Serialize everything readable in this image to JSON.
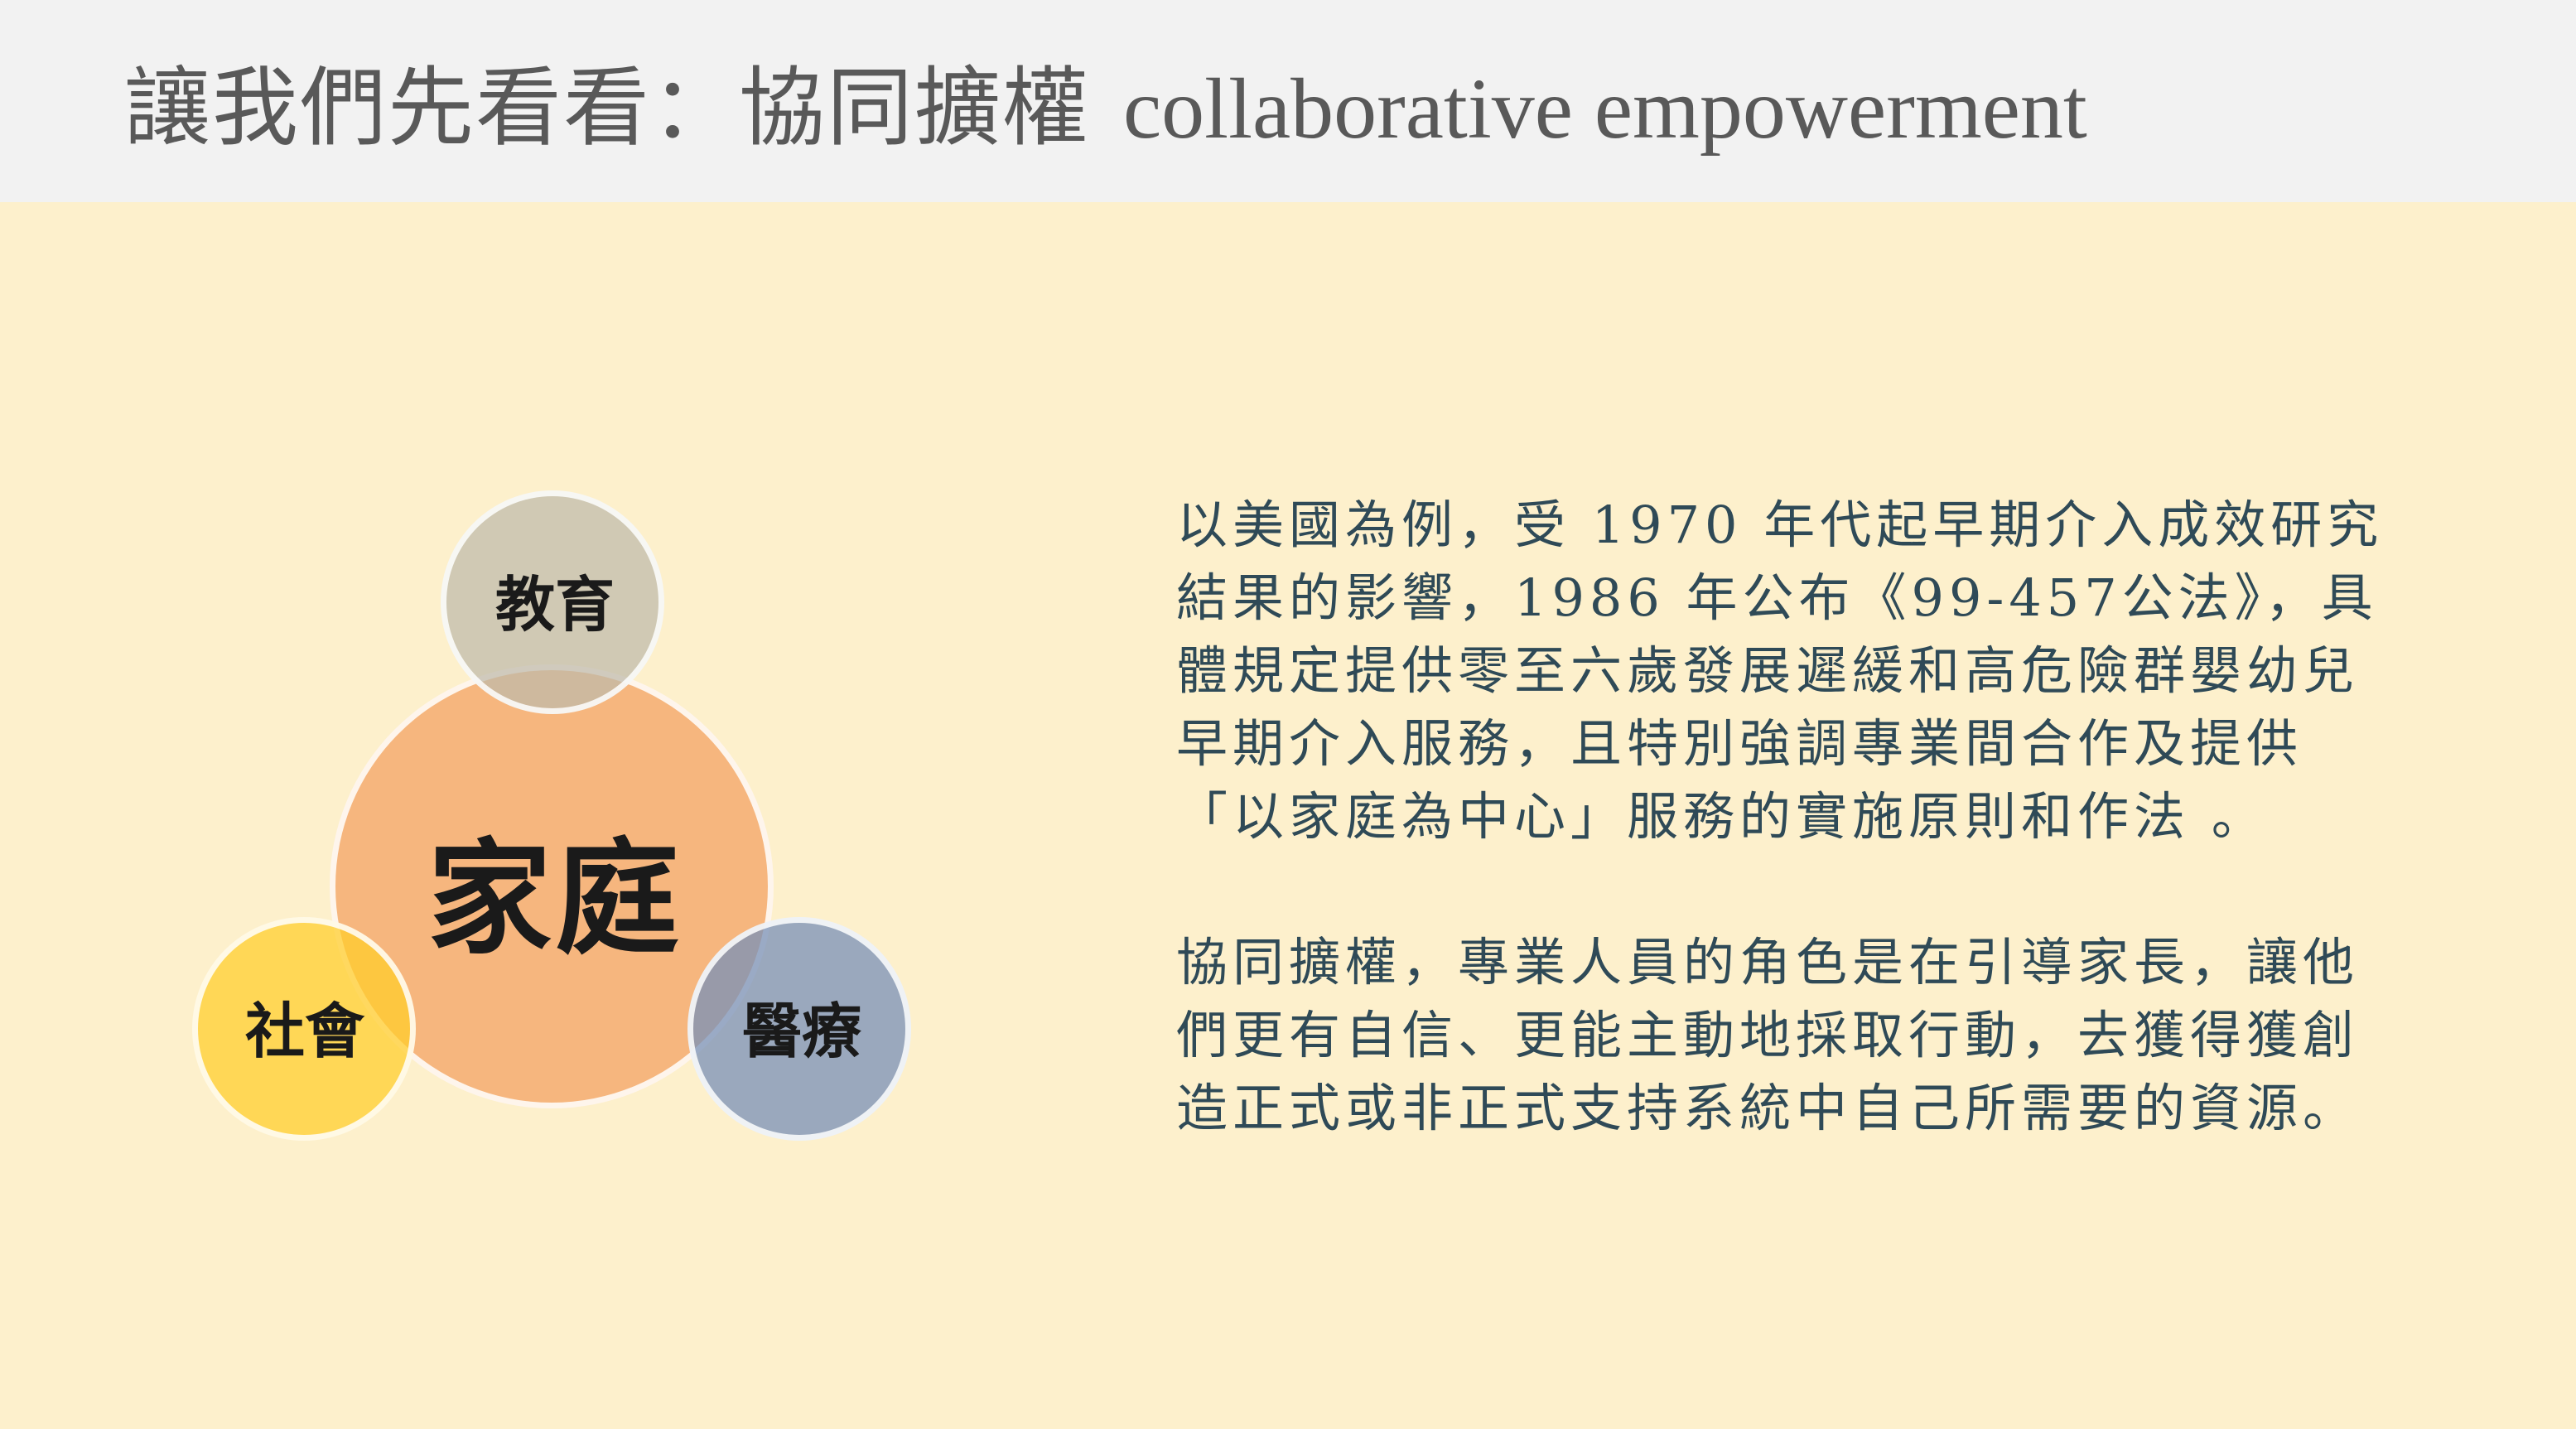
{
  "title": {
    "zh": "讓我們先看看：協同擴權",
    "en": "collaborative empowerment"
  },
  "diagram": {
    "center": "家庭",
    "top": "教育",
    "left": "社會",
    "right": "醫療",
    "colors": {
      "center": "#f4a86c",
      "top": "#bebaaa",
      "left": "#ffcd28",
      "right": "#7890b8"
    }
  },
  "body": {
    "paragraph1": "以美國為例，受 1970 年代起早期介入成效研究\n結果的影響，1986 年公布《99-457公法》，具\n體規定提供零至六歲發展遲緩和高危險群嬰幼兒\n早期介入服務，且特別強調專業間合作及提供\n「以家庭為中心」服務的實施原則和作法 。",
    "paragraph2": "協同擴權，專業人員的角色是在引導家長，讓他\n們更有自信、更能主動地採取行動，去獲得獲創\n造正式或非正式支持系統中自己所需要的資源。"
  }
}
